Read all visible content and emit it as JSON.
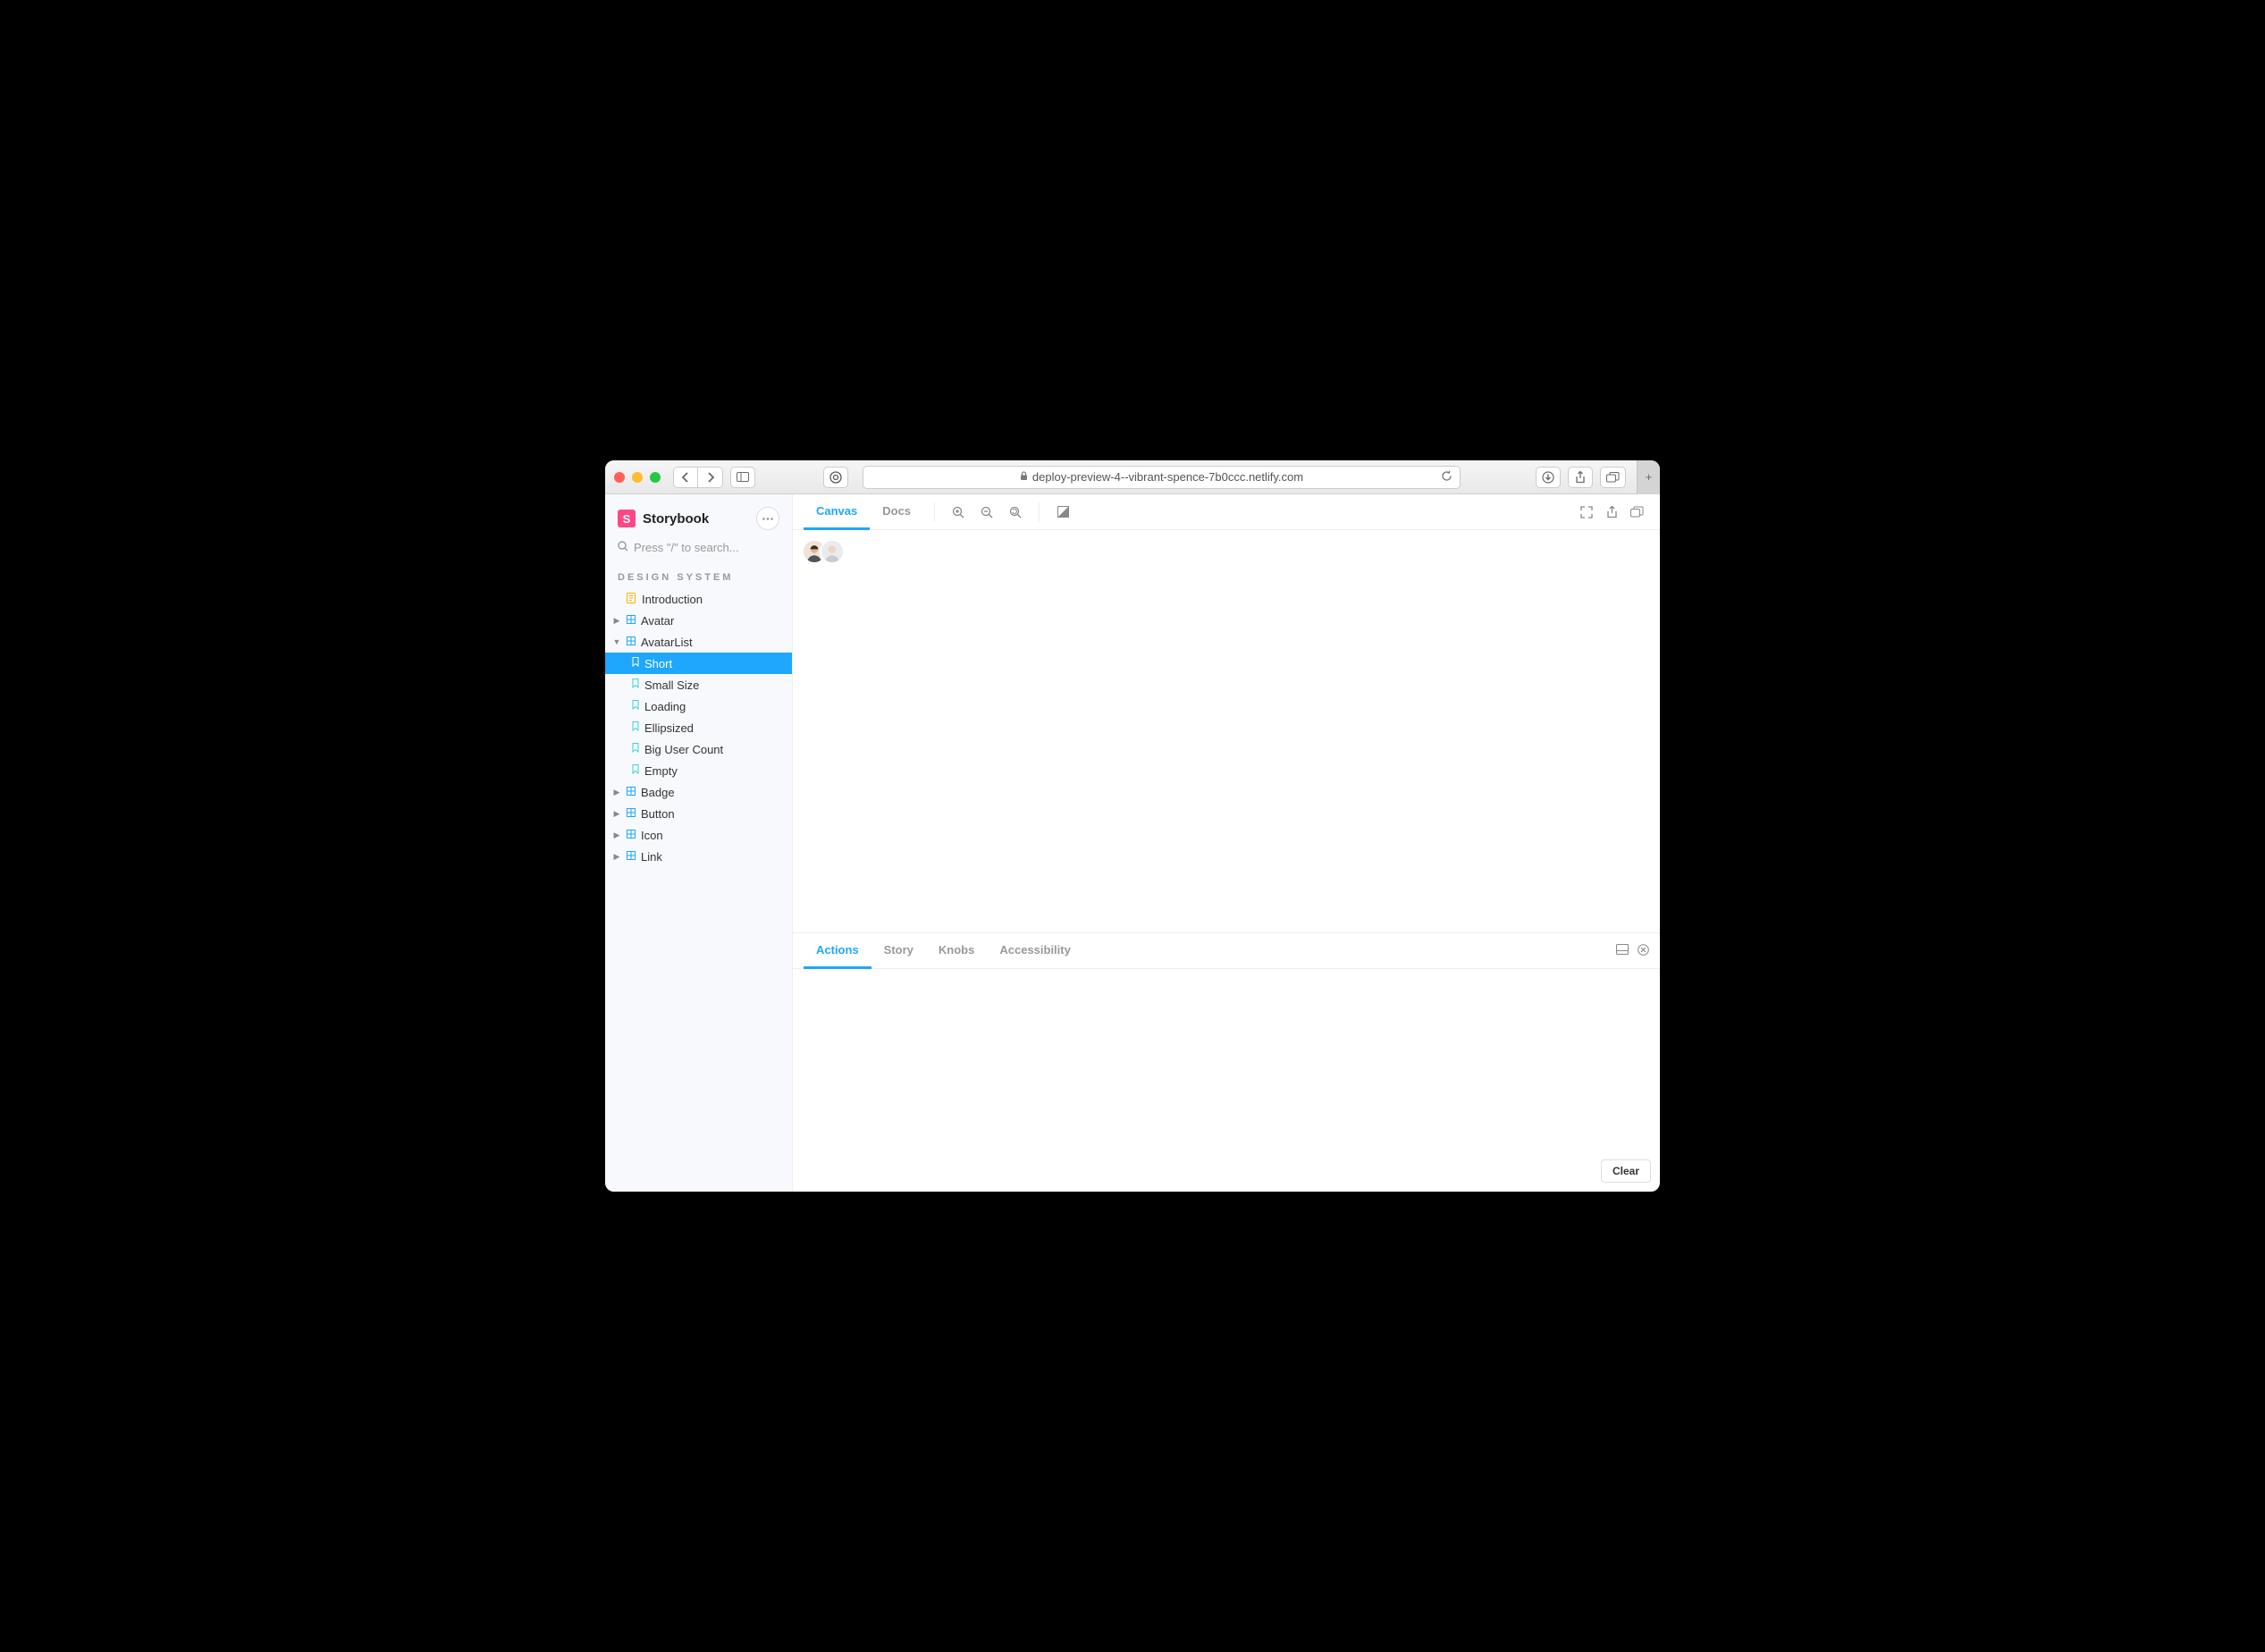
{
  "browser": {
    "url": "deploy-preview-4--vibrant-spence-7b0ccc.netlify.com"
  },
  "brand": {
    "logo_letter": "S",
    "name": "Storybook"
  },
  "search": {
    "placeholder": "Press \"/\" to search..."
  },
  "sidebar": {
    "section_label": "DESIGN SYSTEM",
    "items": [
      {
        "label": "Introduction",
        "type": "doc"
      },
      {
        "label": "Avatar",
        "type": "component",
        "expanded": false
      },
      {
        "label": "AvatarList",
        "type": "component",
        "expanded": true
      },
      {
        "label": "Short",
        "type": "story",
        "selected": true
      },
      {
        "label": "Small Size",
        "type": "story"
      },
      {
        "label": "Loading",
        "type": "story"
      },
      {
        "label": "Ellipsized",
        "type": "story"
      },
      {
        "label": "Big User Count",
        "type": "story"
      },
      {
        "label": "Empty",
        "type": "story"
      },
      {
        "label": "Badge",
        "type": "component",
        "expanded": false
      },
      {
        "label": "Button",
        "type": "component",
        "expanded": false
      },
      {
        "label": "Icon",
        "type": "component",
        "expanded": false
      },
      {
        "label": "Link",
        "type": "component",
        "expanded": false
      }
    ]
  },
  "toolbar": {
    "tabs": {
      "canvas": "Canvas",
      "docs": "Docs"
    }
  },
  "addons": {
    "tabs": {
      "actions": "Actions",
      "story": "Story",
      "knobs": "Knobs",
      "a11y": "Accessibility"
    },
    "clear": "Clear"
  },
  "canvas": {
    "avatar_count": 2
  }
}
